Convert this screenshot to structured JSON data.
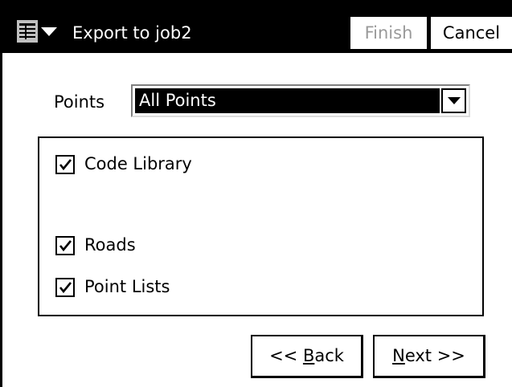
{
  "window": {
    "title": "Export to job2",
    "menu_icon": "start-menu-icon"
  },
  "toolbar": {
    "finish_label": "Finish",
    "cancel_label": "Cancel"
  },
  "points": {
    "label": "Points",
    "selected": "All Points"
  },
  "options": [
    {
      "label": "Code Library",
      "checked": true
    },
    {
      "label": "Roads",
      "checked": true
    },
    {
      "label": "Point Lists",
      "checked": true
    }
  ],
  "wizard": {
    "back_prefix": "<< ",
    "back_accel": "B",
    "back_rest": "ack",
    "next_accel": "N",
    "next_rest": "ext >>"
  },
  "colors": {
    "title_bar": "#000000",
    "selection": "#000000",
    "disabled_text": "#9a9a9a"
  }
}
